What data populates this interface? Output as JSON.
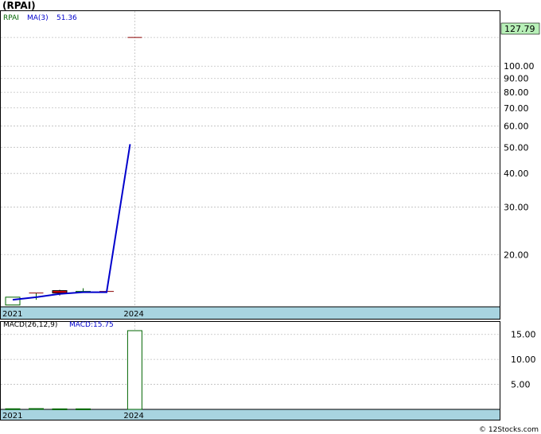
{
  "header": {
    "ticker_title": "(RPAI)"
  },
  "price_panel": {
    "ticker_label": "RPAI",
    "ma_label": "MA(3)",
    "ma_value": "51.36",
    "last_price_badge": "127.79"
  },
  "macd_panel": {
    "macd_params_label": "MACD(26,12,9)",
    "macd_value_label": "MACD:15.75"
  },
  "footer": {
    "copyright": "© 12Stocks.com"
  },
  "colors": {
    "up_candle": "#006400",
    "down_candle": "#cc0000",
    "ma_line": "#0000cc",
    "date_band": "#a8d4e0",
    "badge_bg": "#b8f0b8",
    "grid": "#bfbfbf"
  },
  "chart_data": [
    {
      "type": "candlestick",
      "title": "(RPAI)",
      "scale": "log",
      "ylim": [
        12.8,
        160
      ],
      "y_ticks": [
        20,
        30,
        40,
        50,
        60,
        70,
        80,
        90,
        100
      ],
      "y_tick_labels": [
        "20.00",
        "30.00",
        "40.00",
        "50.00",
        "60.00",
        "70.00",
        "80.00",
        "90.00",
        "100.00"
      ],
      "x_tick_labels": [
        {
          "label": "2021",
          "index": 0
        },
        {
          "label": "2024",
          "index": 5.2
        }
      ],
      "candles": [
        {
          "index": 0,
          "open": 13.0,
          "high": 13.9,
          "low": 13.0,
          "close": 13.9
        },
        {
          "index": 1,
          "open": 14.4,
          "high": 14.4,
          "low": 13.6,
          "close": 14.4
        },
        {
          "index": 2,
          "open": 14.7,
          "high": 14.8,
          "low": 14.1,
          "close": 14.4
        },
        {
          "index": 3,
          "open": 14.5,
          "high": 15.0,
          "low": 14.5,
          "close": 14.6
        },
        {
          "index": 4,
          "open": 14.6,
          "high": 14.6,
          "low": 14.6,
          "close": 14.6
        },
        {
          "index": 5.2,
          "open": 127.79,
          "high": 127.79,
          "low": 127.79,
          "close": 127.79
        }
      ],
      "ma_series": {
        "name": "MA(3)",
        "x": [
          0,
          1,
          2,
          3,
          4,
          5
        ],
        "values": [
          13.6,
          13.9,
          14.3,
          14.5,
          14.5,
          51.36
        ]
      },
      "last_price": 127.79,
      "grid": true
    },
    {
      "type": "bar",
      "title": "MACD(26,12,9)",
      "ylim": [
        0,
        17.5
      ],
      "y_ticks": [
        5,
        10,
        15
      ],
      "y_tick_labels": [
        "5.00",
        "10.00",
        "15.00"
      ],
      "x_tick_labels": [
        {
          "label": "2021",
          "index": 0
        },
        {
          "label": "2024",
          "index": 5.2
        }
      ],
      "bars": [
        {
          "index": 0,
          "value": 0.12
        },
        {
          "index": 1,
          "value": 0.15
        },
        {
          "index": 2,
          "value": 0.1
        },
        {
          "index": 3,
          "value": 0.1
        },
        {
          "index": 5.2,
          "value": 15.75
        }
      ],
      "grid": true
    }
  ]
}
